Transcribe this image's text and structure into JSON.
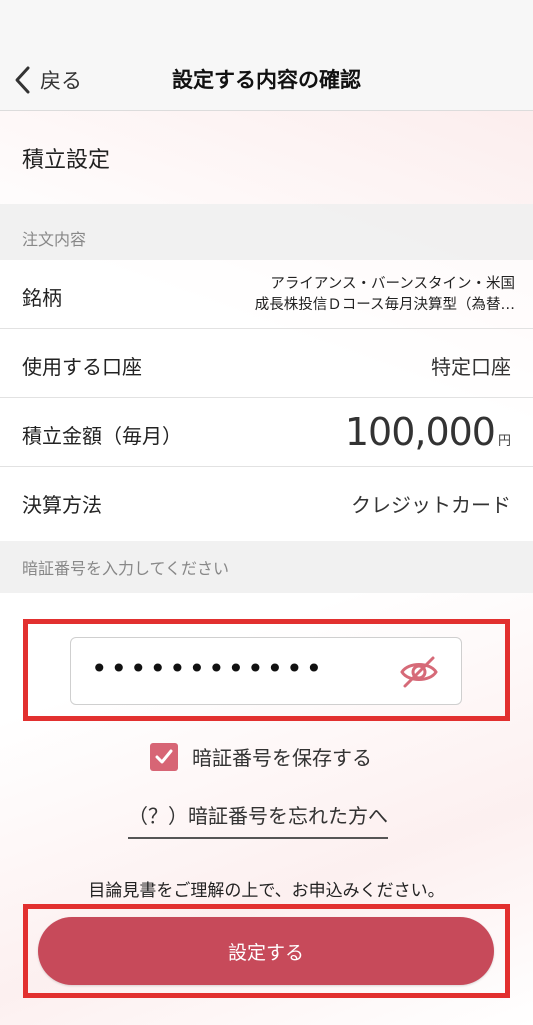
{
  "header": {
    "back_label": "戻る",
    "title": "設定する内容の確認"
  },
  "section": {
    "title": "積立設定"
  },
  "order": {
    "group_label": "注文内容",
    "fund_label": "銘柄",
    "fund_name_line1": "アライアンス・バーンスタイン・米国",
    "fund_name_line2": "成長株投信Ｄコース毎月決算型（為替…",
    "account_label": "使用する口座",
    "account_value": "特定口座",
    "amount_label": "積立金額（毎月）",
    "amount_value": "100,000",
    "amount_unit": "円",
    "settlement_label": "決算方法",
    "settlement_value": "クレジットカード"
  },
  "pin": {
    "group_label": "暗証番号を入力してください",
    "masked_value": "••••••••••••",
    "toggle_icon": "eye-off-icon",
    "save_label": "暗証番号を保存する",
    "save_checked": true,
    "forgot_label": "（？）暗証番号を忘れた方へ"
  },
  "footer": {
    "notice": "目論見書をご理解の上で、お申込みください。",
    "submit_label": "設定する"
  },
  "colors": {
    "accent": "#c74a5a",
    "checkbox": "#d76575",
    "highlight_frame": "#e2302f"
  }
}
